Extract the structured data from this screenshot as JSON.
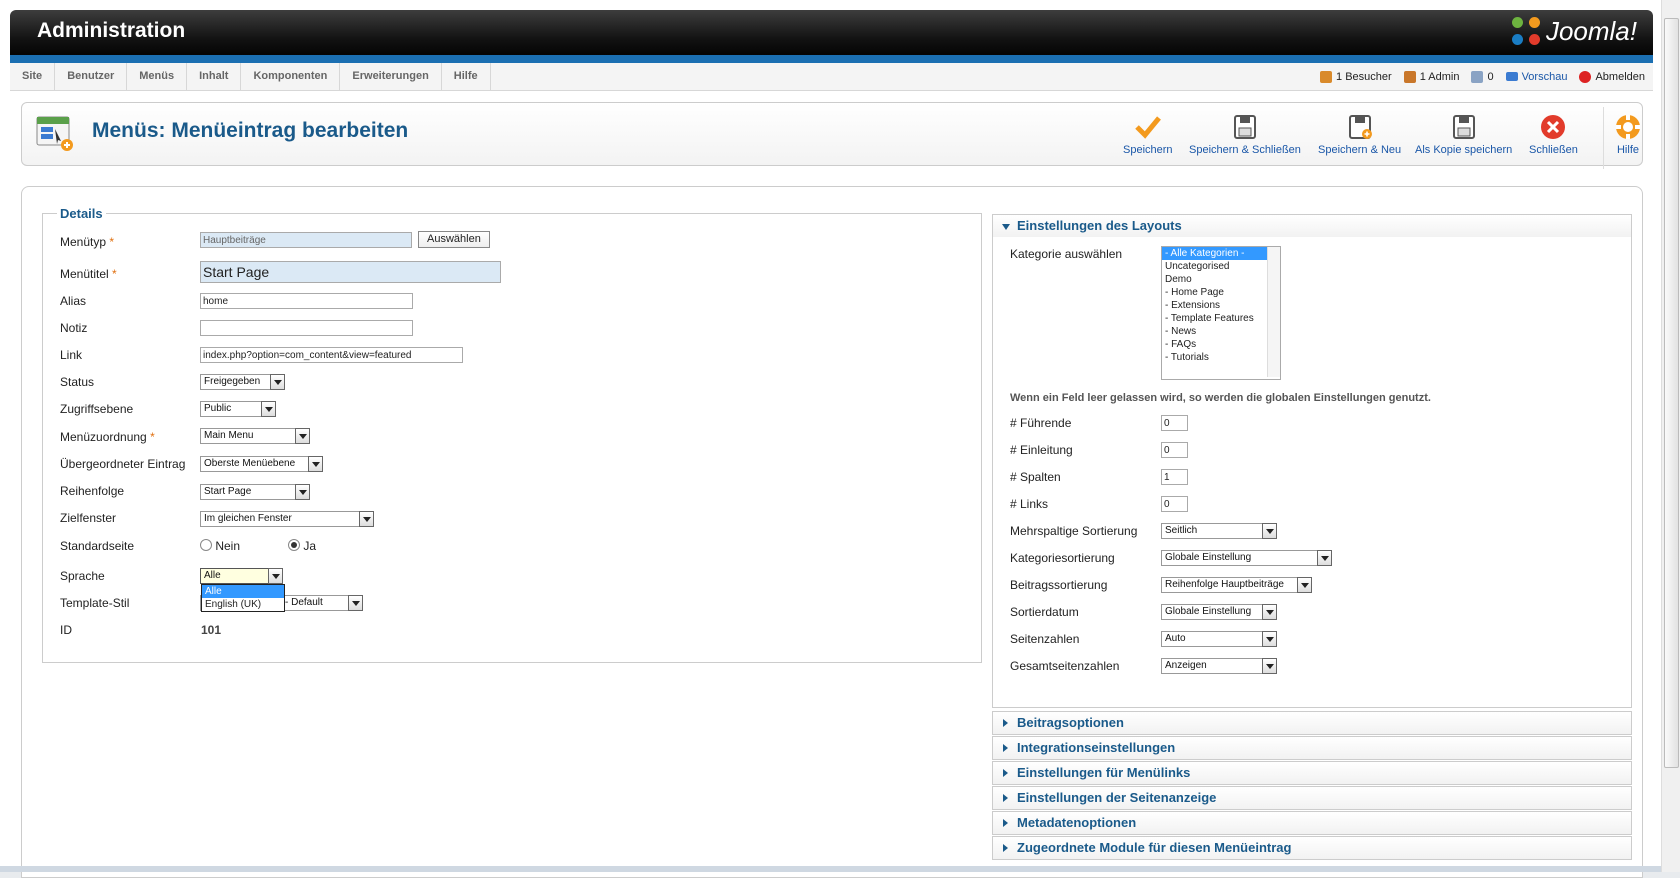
{
  "header": {
    "title": "Administration",
    "logo": "Joomla!"
  },
  "nav": {
    "items": [
      "Site",
      "Benutzer",
      "Menüs",
      "Inhalt",
      "Komponenten",
      "Erweiterungen",
      "Hilfe"
    ],
    "status": {
      "visitors": "1 Besucher",
      "admins": "1 Admin",
      "messages": "0",
      "preview": "Vorschau",
      "logout": "Abmelden"
    }
  },
  "toolbar": {
    "page_title": "Menüs: Menüeintrag bearbeiten",
    "save": "Speichern",
    "save_close": "Speichern & Schließen",
    "save_new": "Speichern & Neu",
    "save_copy": "Als Kopie speichern",
    "close": "Schließen",
    "help": "Hilfe"
  },
  "details": {
    "legend": "Details",
    "menu_type": {
      "label": "Menütyp",
      "value": "Hauptbeiträge",
      "button": "Auswählen"
    },
    "menu_title": {
      "label": "Menütitel",
      "value": "Start Page"
    },
    "alias": {
      "label": "Alias",
      "value": "home"
    },
    "note": {
      "label": "Notiz",
      "value": ""
    },
    "link": {
      "label": "Link",
      "value": "index.php?option=com_content&view=featured"
    },
    "status": {
      "label": "Status",
      "value": "Freigegeben"
    },
    "access": {
      "label": "Zugriffsebene",
      "value": "Public"
    },
    "menu_assignment": {
      "label": "Menüzuordnung",
      "value": "Main Menu"
    },
    "parent": {
      "label": "Übergeordneter Eintrag",
      "value": "Oberste Menüebene"
    },
    "ordering": {
      "label": "Reihenfolge",
      "value": "Start Page"
    },
    "target": {
      "label": "Zielfenster",
      "value": "Im gleichen Fenster"
    },
    "default_page": {
      "label": "Standardseite",
      "no": "Nein",
      "yes": "Ja"
    },
    "language": {
      "label": "Sprache",
      "value": "Alle",
      "options": [
        "Alle",
        "English (UK)"
      ]
    },
    "template_style": {
      "label": "Template-Stil",
      "value": "- Default"
    },
    "id": {
      "label": "ID",
      "value": "101"
    }
  },
  "layout": {
    "title": "Einstellungen des Layouts",
    "category_label": "Kategorie auswählen",
    "categories": [
      "- Alle Kategorien -",
      "Uncategorised",
      "Demo",
      "- Home Page",
      "- Extensions",
      "- Template Features",
      "- News",
      "- FAQs",
      "- Tutorials"
    ],
    "note": "Wenn ein Feld leer gelassen wird, so werden die globalen Einstellungen genutzt.",
    "leading": {
      "label": "# Führende",
      "value": "0"
    },
    "intro": {
      "label": "# Einleitung",
      "value": "0"
    },
    "columns": {
      "label": "# Spalten",
      "value": "1"
    },
    "links": {
      "label": "# Links",
      "value": "0"
    },
    "multi_column_order": {
      "label": "Mehrspaltige Sortierung",
      "value": "Seitlich"
    },
    "category_order": {
      "label": "Kategoriesortierung",
      "value": "Globale Einstellung"
    },
    "article_order": {
      "label": "Beitragssortierung",
      "value": "Reihenfolge Hauptbeiträge"
    },
    "date_for_order": {
      "label": "Sortierdatum",
      "value": "Globale Einstellung"
    },
    "pagination": {
      "label": "Seitenzahlen",
      "value": "Auto"
    },
    "pagination_results": {
      "label": "Gesamtseitenzahlen",
      "value": "Anzeigen"
    }
  },
  "panels": {
    "article": "Beitragsoptionen",
    "integration": "Integrationseinstellungen",
    "link_type": "Einstellungen für Menülinks",
    "page_display": "Einstellungen der Seitenanzeige",
    "metadata": "Metadatenoptionen",
    "modules": "Zugeordnete Module für diesen Menüeintrag"
  }
}
